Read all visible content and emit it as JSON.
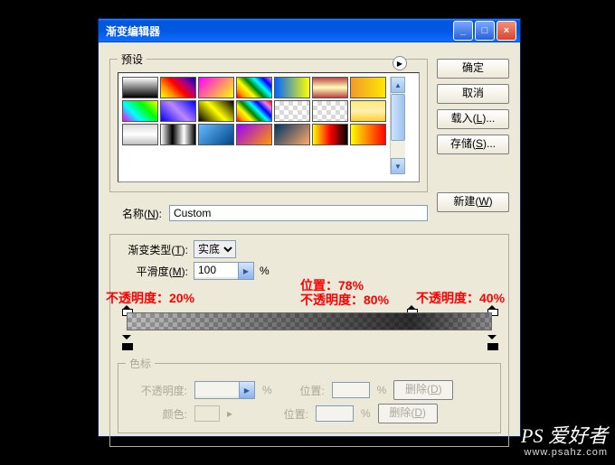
{
  "window": {
    "title": "渐变编辑器",
    "min": "_",
    "max": "□",
    "close": "×"
  },
  "presets": {
    "legend": "预设",
    "play": "▶",
    "sb_up": "▲",
    "sb_down": "▼",
    "swatches": [
      "linear-gradient(#fff,#000)",
      "linear-gradient(45deg,#ff0,#f90,#f00,#909,#009)",
      "linear-gradient(135deg,#f0f,#ff0)",
      "linear-gradient(45deg,red,orange,yellow,green,cyan,blue,violet)",
      "linear-gradient(90deg,#06f,#ff0)",
      "linear-gradient(#b44,#ffb,#b44)",
      "linear-gradient(90deg,#f19a2a,#ffe800)",
      "linear-gradient(45deg,#f0f,#0ff,#0f0,#ff0)",
      "linear-gradient(45deg,#00f,#b8f,#00f)",
      "linear-gradient(45deg,#000,#ff0,#000)",
      "linear-gradient(45deg,red,orange,yellow,green,cyan,blue,violet,red)",
      "conic-gradient(#d9d9d9 25%, #ffffff 0 50%, #d9d9d9 0 75%, #ffffff 0)",
      "conic-gradient(#d9d9d9 25%, #ffffff 0 50%, #d9d9d9 0 75%, #ffffff 0)",
      "linear-gradient(#ffe97a,#fff0b0,#ffd030)",
      "linear-gradient(#dadada,#ffffff,#bfbfbf)",
      "linear-gradient(90deg,#fff,#000,#fff,#000)",
      "linear-gradient(135deg,#6bf,#048)",
      "linear-gradient(135deg,#90f,#f90)",
      "linear-gradient(135deg,#036,#fa6)",
      "linear-gradient(90deg,#ff0,#f00,#000)",
      "linear-gradient(90deg,#ff0,#f00)"
    ]
  },
  "buttons": {
    "ok": "确定",
    "cancel": "取消",
    "load": "载入(<u>L</u>)...",
    "save": "存储(<u>S</u>)...",
    "new": "新建(<u>W</u>)"
  },
  "name": {
    "label": "名称(<u>N</u>):",
    "value": "Custom"
  },
  "grad": {
    "type_label": "渐变类型(<u>T</u>):",
    "type_value": "实底",
    "smooth_label": "平滑度(<u>M</u>):",
    "smooth_value": "100",
    "smooth_step": "▶",
    "pct": "%"
  },
  "annotations": {
    "a1": "不透明度：20%",
    "a2": "位置：78%\n不透明度：80%",
    "a3": "不透明度：40%"
  },
  "stops_legend": "色标",
  "stops": {
    "opacity_label": "不透明度:",
    "color_label": "颜色:",
    "pos_label": "位置:",
    "delete": "删除(<u>D</u>)",
    "pct": "%"
  },
  "watermark": {
    "main": "PS 爱好者",
    "url": "www.psahz.com"
  }
}
